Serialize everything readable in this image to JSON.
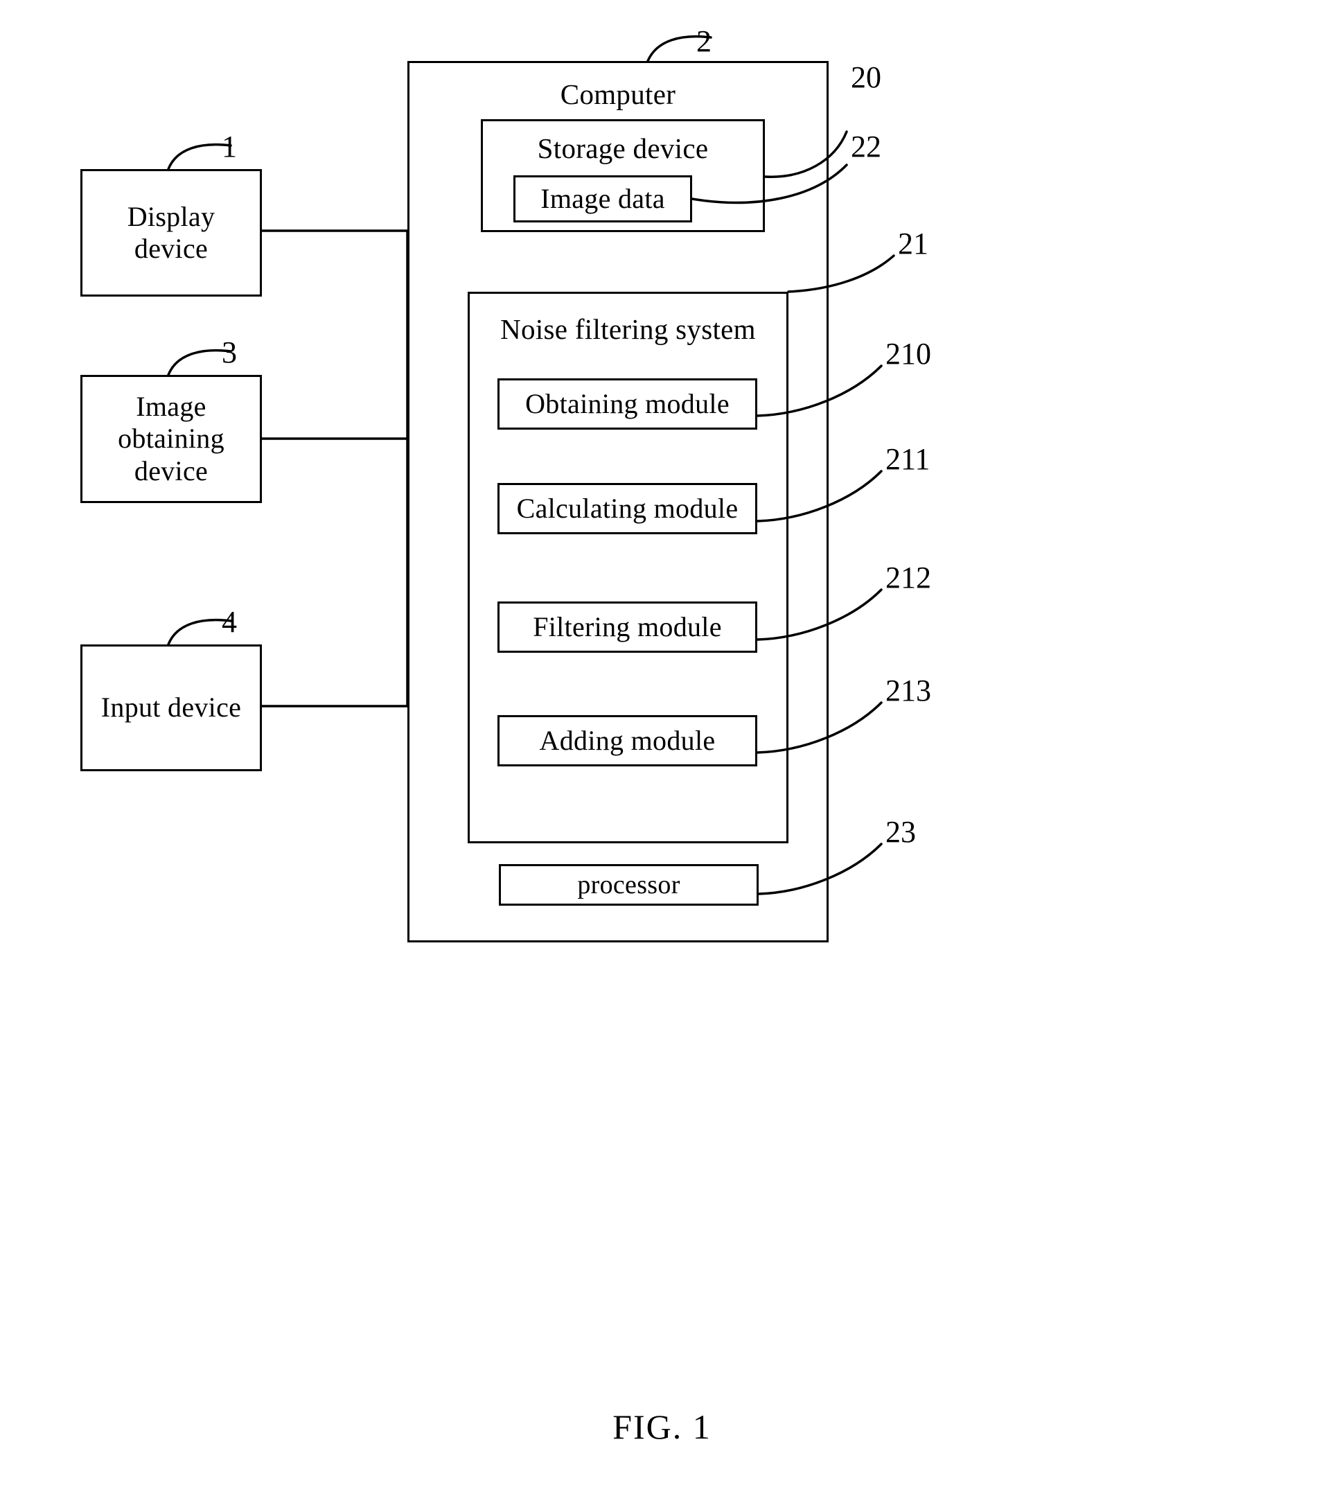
{
  "figure": {
    "caption": "FIG. 1"
  },
  "computer": {
    "title": "Computer",
    "ref": "2",
    "storage": {
      "title": "Storage device",
      "ref": "20",
      "image_data": {
        "label": "Image data",
        "ref": "22"
      }
    },
    "noise_system": {
      "title": "Noise filtering system",
      "ref": "21",
      "modules": [
        {
          "label": "Obtaining module",
          "ref": "210"
        },
        {
          "label": "Calculating module",
          "ref": "211"
        },
        {
          "label": "Filtering module",
          "ref": "212"
        },
        {
          "label": "Adding module",
          "ref": "213"
        }
      ]
    },
    "processor": {
      "label": "processor",
      "ref": "23"
    }
  },
  "peripherals": [
    {
      "label": "Display\ndevice",
      "ref": "1"
    },
    {
      "label": "Image\nobtaining\ndevice",
      "ref": "3"
    },
    {
      "label": "Input device",
      "ref": "4"
    }
  ]
}
